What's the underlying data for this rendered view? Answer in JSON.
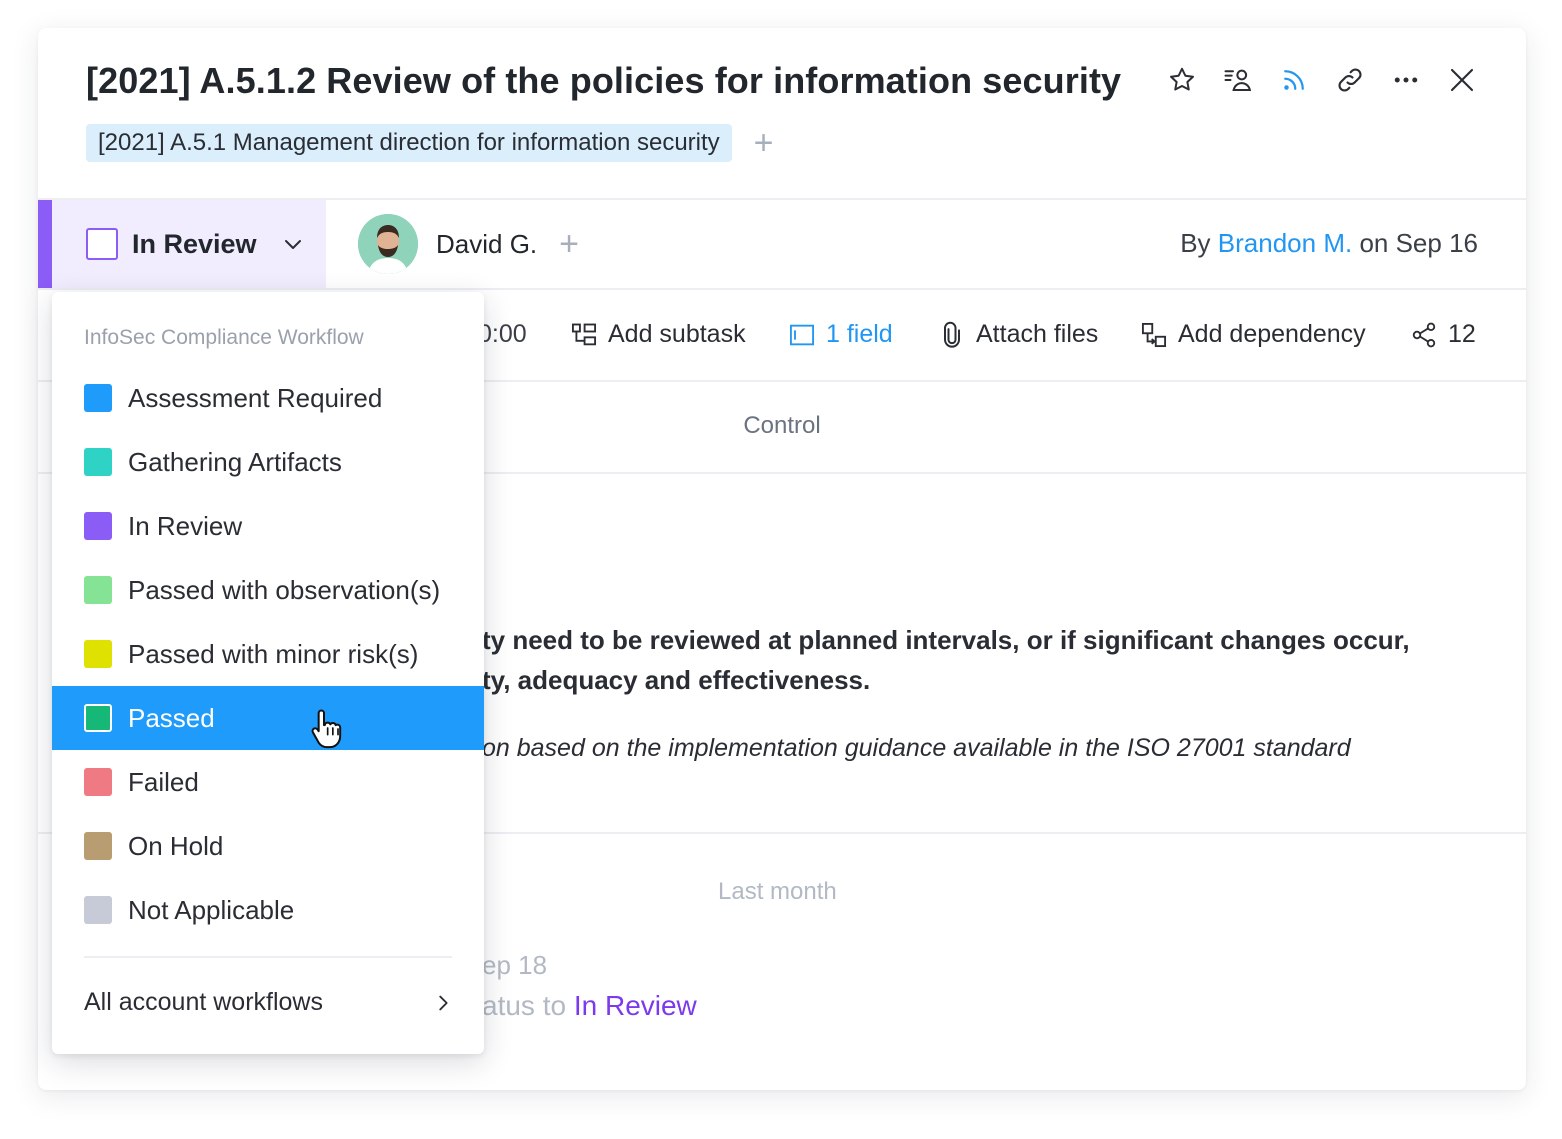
{
  "task": {
    "title": "[2021] A.5.1.2 Review of the policies for information security",
    "parent_tag": "[2021] A.5.1 Management direction for information security"
  },
  "header_icons": [
    "star-icon",
    "assign-icon",
    "feed-icon",
    "link-icon",
    "more-icon",
    "close-icon"
  ],
  "status": {
    "current": "In Review",
    "color": "#8b5cf6"
  },
  "assignee": {
    "name": "David G."
  },
  "author": {
    "prefix": "By",
    "name": "Brandon M.",
    "suffix": "on Sep 16"
  },
  "toolbar": {
    "time": "0:00",
    "add_subtask": "Add subtask",
    "fields": "1 field",
    "attach": "Attach files",
    "dependency": "Add dependency",
    "share_count": "12"
  },
  "section": {
    "title": "Control"
  },
  "description": {
    "line1": "ty need to be reviewed at planned intervals, or if significant changes occur,",
    "line2": "ty, adequacy and effectiveness.",
    "italic": "on based on the implementation guidance available in the ISO 27001 standard"
  },
  "activity": {
    "month": "Last month",
    "date": "ep 18",
    "text": "atus to",
    "status": "In Review"
  },
  "dropdown": {
    "header": "InfoSec Compliance Workflow",
    "items": [
      {
        "label": "Assessment Required",
        "color": "#1e9bfb"
      },
      {
        "label": "Gathering Artifacts",
        "color": "#2ed3c6"
      },
      {
        "label": "In Review",
        "color": "#8b5cf6"
      },
      {
        "label": "Passed with observation(s)",
        "color": "#84e394"
      },
      {
        "label": "Passed with minor risk(s)",
        "color": "#dfe200"
      },
      {
        "label": "Passed",
        "color": "#16b877"
      },
      {
        "label": "Failed",
        "color": "#f07a83"
      },
      {
        "label": "On Hold",
        "color": "#b79d71"
      },
      {
        "label": "Not Applicable",
        "color": "#c7cbd8"
      }
    ],
    "selected_label": "Passed",
    "footer": "All account workflows"
  }
}
